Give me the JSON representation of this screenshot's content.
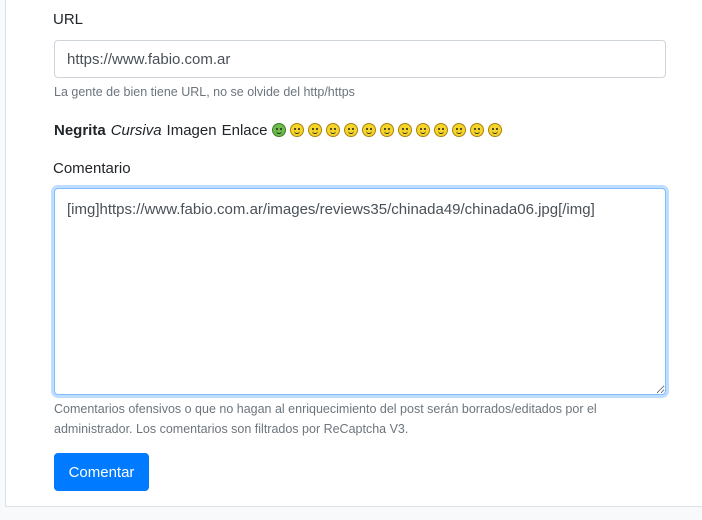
{
  "url_field": {
    "label": "URL",
    "value": "https://www.fabio.com.ar",
    "help": "La gente de bien tiene URL, no se olvide del http/https"
  },
  "toolbar": {
    "bold": "Negrita",
    "italic": "Cursiva",
    "image": "Imagen",
    "link": "Enlace",
    "emoticons": [
      "grin-green-icon",
      "smile-icon",
      "happy-icon",
      "tongue-icon",
      "sad-icon",
      "frown-icon",
      "cool-icon",
      "confused-icon",
      "rolleyes-icon",
      "neutral-icon",
      "meh-icon",
      "shocked-icon",
      "laugh-icon"
    ]
  },
  "comment_field": {
    "label": "Comentario",
    "value": "[img]https://www.fabio.com.ar/images/reviews35/chinada49/chinada06.jpg[/img]",
    "help": "Comentarios ofensivos o que no hagan al enriquecimiento del post serán borrados/editados por el administrador. Los comentarios son filtrados por ReCaptcha V3."
  },
  "submit_label": "Comentar",
  "colors": {
    "primary": "#007bff",
    "focus_border": "#80bdff",
    "muted_text": "#6c757d"
  }
}
